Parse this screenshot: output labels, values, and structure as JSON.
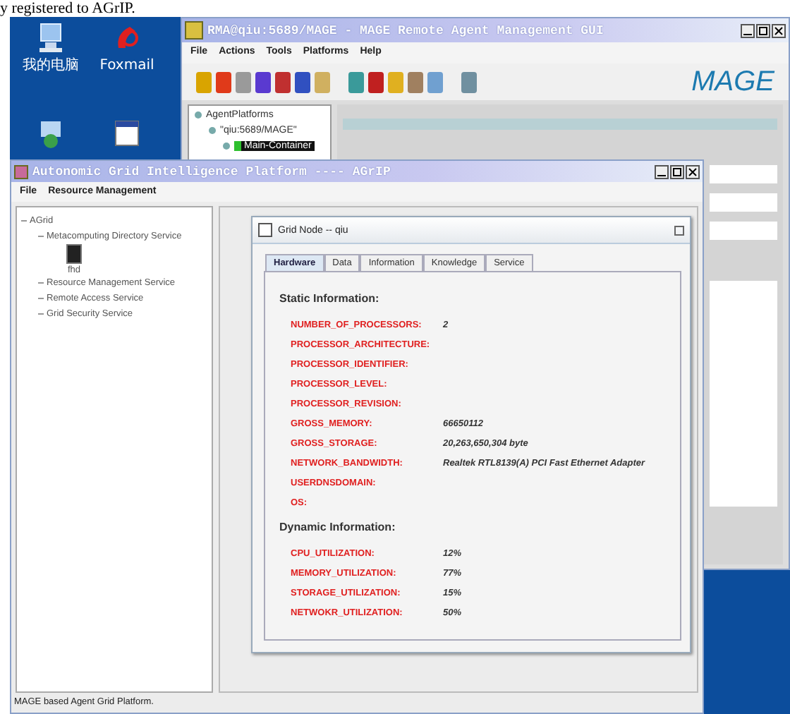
{
  "document_text": "y registered to AGrIP.",
  "desktop_icons": [
    {
      "kind": "computer",
      "label": "我的电脑"
    },
    {
      "kind": "mail",
      "label": "Foxmail"
    },
    {
      "kind": "network"
    },
    {
      "kind": "window"
    }
  ],
  "mage_window": {
    "title": "RMA@qiu:5689/MAGE - MAGE Remote Agent Management GUI",
    "menu": [
      "File",
      "Actions",
      "Tools",
      "Platforms",
      "Help"
    ],
    "logo": "MAGE",
    "tree": [
      {
        "label": "AgentPlatforms",
        "selected": false,
        "children": [
          {
            "label": "\"qiu:5689/MAGE\"",
            "selected": false,
            "children": [
              {
                "label": "Main-Container",
                "selected": true
              }
            ]
          }
        ]
      }
    ]
  },
  "agrip_window": {
    "title": "Autonomic Grid Intelligence Platform ---- AGrIP",
    "menu": [
      "File",
      "Resource Management"
    ],
    "tree": [
      {
        "label": "AGrid",
        "children": [
          {
            "label": "Metacomputing Directory Service",
            "children": [
              {
                "label": "fhd",
                "kind": "host"
              }
            ]
          },
          {
            "label": "Resource Management Service"
          },
          {
            "label": "Remote Access Service"
          },
          {
            "label": "Grid Security Service"
          }
        ]
      }
    ],
    "internal_frame": {
      "title": "Grid Node -- qiu",
      "tabs": [
        {
          "label": "Hardware",
          "selected": true
        },
        {
          "label": "Data",
          "selected": false
        },
        {
          "label": "Information",
          "selected": false
        },
        {
          "label": "Knowledge",
          "selected": false
        },
        {
          "label": "Service",
          "selected": false
        }
      ],
      "sections": [
        {
          "heading": "Static Information:",
          "rows": [
            {
              "key": "NUMBER_OF_PROCESSORS:",
              "value": "2"
            },
            {
              "key": "PROCESSOR_ARCHITECTURE:"
            },
            {
              "key": "PROCESSOR_IDENTIFIER:"
            },
            {
              "key": "PROCESSOR_LEVEL:"
            },
            {
              "key": "PROCESSOR_REVISION:"
            },
            {
              "key": "GROSS_MEMORY:",
              "value": "66650112"
            },
            {
              "key": "GROSS_STORAGE:",
              "value": "20,263,650,304 byte"
            },
            {
              "key": "NETWORK_BANDWIDTH:",
              "value": "Realtek RTL8139(A) PCI Fast Ethernet Adapter"
            },
            {
              "key": "USERDNSDOMAIN:"
            },
            {
              "key": "OS:"
            }
          ]
        },
        {
          "heading": "Dynamic Information:",
          "rows": [
            {
              "key": "CPU_UTILIZATION:",
              "value": "12%"
            },
            {
              "key": "MEMORY_UTILIZATION:",
              "value": "77%"
            },
            {
              "key": "STORAGE_UTILIZATION:",
              "value": "15%"
            },
            {
              "key": "NETWOKR_UTILIZATION:",
              "value": "50%"
            }
          ]
        }
      ]
    },
    "status_bar": "MAGE based Agent Grid Platform."
  }
}
